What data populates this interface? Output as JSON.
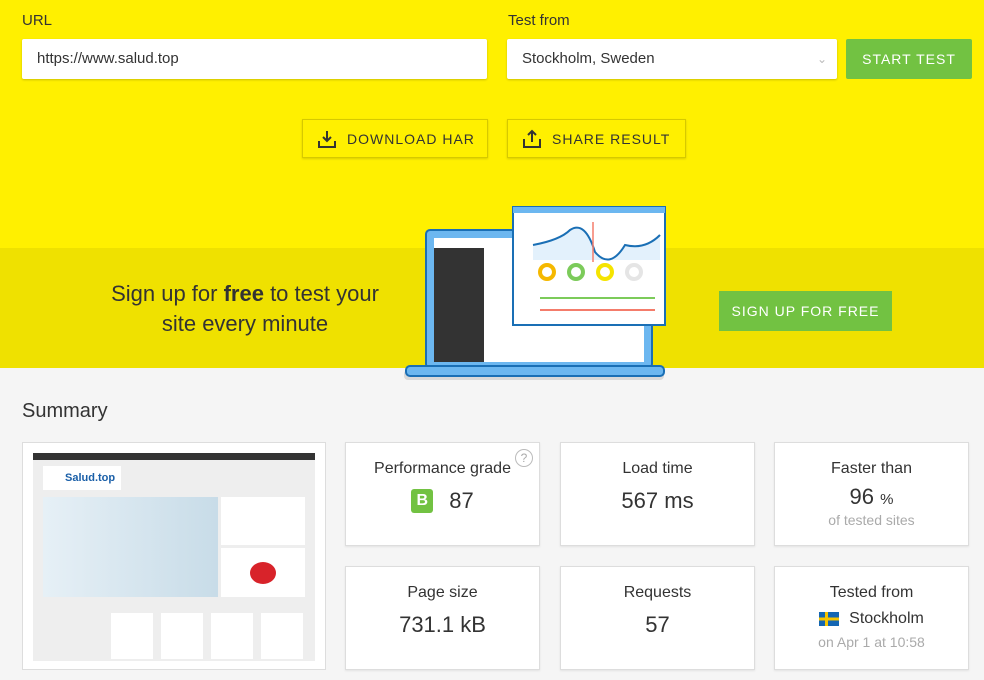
{
  "form": {
    "url_label": "URL",
    "url_value": "https://www.salud.top",
    "location_label": "Test from",
    "location_value": "Stockholm, Sweden",
    "start_label": "START TEST"
  },
  "actions": {
    "download": "DOWNLOAD HAR",
    "share": "SHARE RESULT"
  },
  "banner": {
    "pre": "Sign up for ",
    "bold": "free",
    "post": " to test your site every minute",
    "button": "SIGN UP FOR FREE"
  },
  "summary": {
    "title": "Summary",
    "thumbnail_logo": "Salud.top",
    "grade": {
      "label": "Performance grade",
      "letter": "B",
      "value": "87",
      "help": "?"
    },
    "load": {
      "label": "Load time",
      "value": "567 ms"
    },
    "faster": {
      "label": "Faster than",
      "value": "96",
      "unit": "%",
      "sub": "of tested sites"
    },
    "size": {
      "label": "Page size",
      "value": "731.1 kB"
    },
    "requests": {
      "label": "Requests",
      "value": "57"
    },
    "tested": {
      "label": "Tested from",
      "city": "Stockholm",
      "when": "on Apr 1 at 10:58"
    }
  },
  "colors": {
    "yellow": "#fff000",
    "banner": "#efe100",
    "green": "#72c242"
  }
}
